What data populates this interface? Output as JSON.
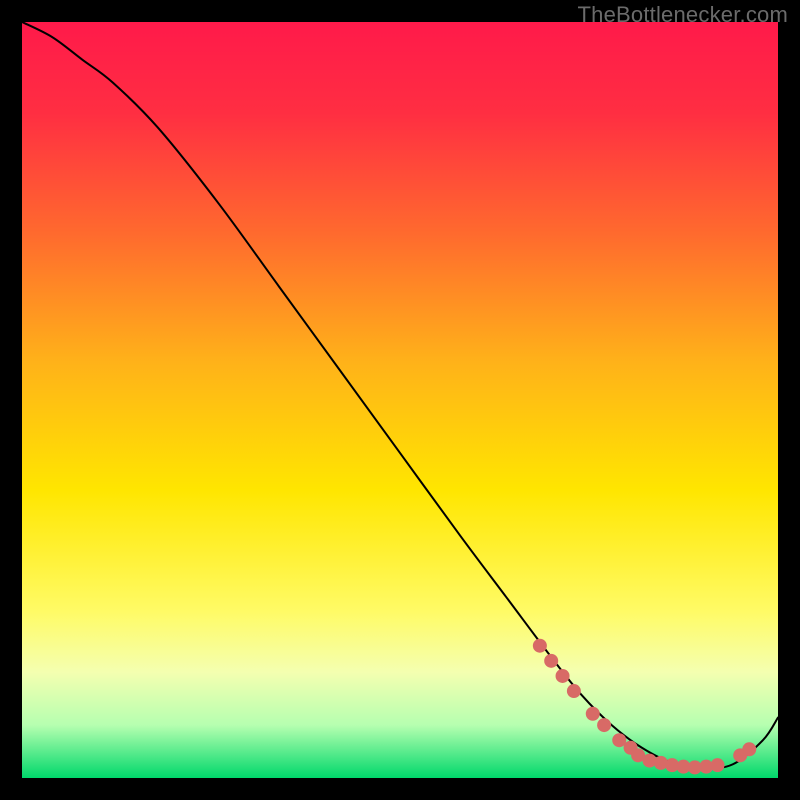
{
  "watermark": "TheBottlenecker.com",
  "chart_data": {
    "type": "line",
    "title": "",
    "xlabel": "",
    "ylabel": "",
    "xlim": [
      0,
      100
    ],
    "ylim": [
      0,
      100
    ],
    "background_gradient": {
      "stops": [
        {
          "offset": 0.0,
          "color": "#ff1a4a"
        },
        {
          "offset": 0.12,
          "color": "#ff2e42"
        },
        {
          "offset": 0.28,
          "color": "#ff6a2e"
        },
        {
          "offset": 0.45,
          "color": "#ffb219"
        },
        {
          "offset": 0.62,
          "color": "#ffe600"
        },
        {
          "offset": 0.78,
          "color": "#fffb66"
        },
        {
          "offset": 0.86,
          "color": "#f4ffb0"
        },
        {
          "offset": 0.93,
          "color": "#b6ffb0"
        },
        {
          "offset": 1.0,
          "color": "#00d86b"
        }
      ]
    },
    "series": [
      {
        "name": "bottleneck-curve",
        "color": "#000000",
        "stroke_width": 2,
        "x": [
          0,
          4,
          8,
          12,
          18,
          26,
          34,
          42,
          50,
          58,
          64,
          70,
          74,
          78,
          82,
          86,
          90,
          94,
          98,
          100
        ],
        "y": [
          100,
          98,
          95,
          92,
          86,
          76,
          65,
          54,
          43,
          32,
          24,
          16,
          11,
          7,
          4,
          2.0,
          1.3,
          1.8,
          5,
          8
        ]
      }
    ],
    "marker_series": {
      "name": "highlighted-points",
      "color": "#d86a66",
      "radius": 7,
      "points": [
        {
          "x": 68.5,
          "y": 17.5
        },
        {
          "x": 70.0,
          "y": 15.5
        },
        {
          "x": 71.5,
          "y": 13.5
        },
        {
          "x": 73.0,
          "y": 11.5
        },
        {
          "x": 75.5,
          "y": 8.5
        },
        {
          "x": 77.0,
          "y": 7.0
        },
        {
          "x": 79.0,
          "y": 5.0
        },
        {
          "x": 80.5,
          "y": 4.0
        },
        {
          "x": 81.5,
          "y": 3.0
        },
        {
          "x": 83.0,
          "y": 2.3
        },
        {
          "x": 84.5,
          "y": 2.0
        },
        {
          "x": 86.0,
          "y": 1.7
        },
        {
          "x": 87.5,
          "y": 1.5
        },
        {
          "x": 89.0,
          "y": 1.4
        },
        {
          "x": 90.5,
          "y": 1.5
        },
        {
          "x": 92.0,
          "y": 1.7
        },
        {
          "x": 95.0,
          "y": 3.0
        },
        {
          "x": 96.2,
          "y": 3.8
        }
      ]
    }
  }
}
